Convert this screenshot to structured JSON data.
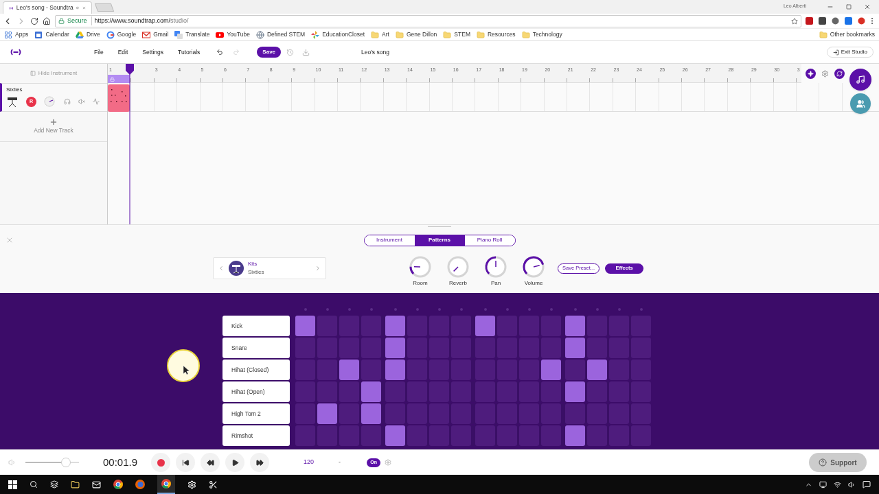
{
  "browser": {
    "tab": {
      "title": "Leo's song - Soundtra"
    },
    "user": "Leo Alberti",
    "secure": "Secure",
    "url": {
      "host": "https://www.soundtrap.com/",
      "path": "studio/"
    },
    "bookmarks": [
      {
        "label": "Apps",
        "kind": "apps"
      },
      {
        "label": "Calendar",
        "kind": "calendar"
      },
      {
        "label": "Drive",
        "kind": "drive"
      },
      {
        "label": "Google",
        "kind": "google"
      },
      {
        "label": "Gmail",
        "kind": "gmail"
      },
      {
        "label": "Translate",
        "kind": "translate"
      },
      {
        "label": "YouTube",
        "kind": "youtube"
      },
      {
        "label": "Defined STEM",
        "kind": "site"
      },
      {
        "label": "EducationCloset",
        "kind": "pinwheel"
      },
      {
        "label": "Art",
        "kind": "folder"
      },
      {
        "label": "Gene Dillon",
        "kind": "folder"
      },
      {
        "label": "STEM",
        "kind": "folder"
      },
      {
        "label": "Resources",
        "kind": "folder"
      },
      {
        "label": "Technology",
        "kind": "folder"
      }
    ],
    "other_bookmarks": "Other bookmarks"
  },
  "app": {
    "menu": [
      "File",
      "Edit",
      "Settings",
      "Tutorials"
    ],
    "save": "Save",
    "title": "Leo's song",
    "exit": "Exit Studio"
  },
  "tracks_panel": {
    "hide_instrument": "Hide Instrument",
    "tracks": [
      {
        "name": "Sixties",
        "selected": true,
        "record": "R"
      }
    ],
    "add_track": "Add New Track"
  },
  "ruler": [
    "1",
    "3",
    "4",
    "5",
    "6",
    "7",
    "8",
    "9",
    "10",
    "11",
    "12",
    "13",
    "14",
    "15",
    "16",
    "17",
    "18",
    "19",
    "20",
    "21",
    "22",
    "23",
    "24",
    "25",
    "26",
    "27",
    "28",
    "29",
    "30",
    "3"
  ],
  "instrument": {
    "tabs": [
      {
        "label": "Instrument",
        "selected": false
      },
      {
        "label": "Patterns",
        "selected": true
      },
      {
        "label": "Piano Roll",
        "selected": false
      }
    ],
    "kit": {
      "category": "Kits",
      "name": "Sixties"
    },
    "knobs": [
      {
        "label": "Room"
      },
      {
        "label": "Reverb"
      },
      {
        "label": "Pan"
      },
      {
        "label": "Volume"
      }
    ],
    "save_preset": "Save Preset...",
    "effects": "Effects"
  },
  "sequencer": {
    "rows": [
      {
        "label": "Kick",
        "steps": [
          true,
          false,
          false,
          false,
          true,
          false,
          false,
          false,
          true,
          false,
          false,
          false,
          true,
          false,
          false,
          false
        ]
      },
      {
        "label": "Snare",
        "steps": [
          false,
          false,
          false,
          false,
          true,
          false,
          false,
          false,
          false,
          false,
          false,
          false,
          true,
          false,
          false,
          false
        ]
      },
      {
        "label": "Hihat (Closed)",
        "steps": [
          false,
          false,
          true,
          false,
          true,
          false,
          false,
          false,
          false,
          false,
          false,
          true,
          false,
          true,
          false,
          false
        ]
      },
      {
        "label": "Hihat (Open)",
        "steps": [
          false,
          false,
          false,
          true,
          false,
          false,
          false,
          false,
          false,
          false,
          false,
          false,
          true,
          false,
          false,
          false
        ]
      },
      {
        "label": "High Tom 2",
        "steps": [
          false,
          true,
          false,
          true,
          false,
          false,
          false,
          false,
          false,
          false,
          false,
          false,
          false,
          false,
          false,
          false
        ]
      },
      {
        "label": "Rimshot",
        "steps": [
          false,
          false,
          false,
          false,
          true,
          false,
          false,
          false,
          false,
          false,
          false,
          false,
          true,
          false,
          false,
          false
        ]
      }
    ]
  },
  "transport": {
    "volume": {
      "level": 0.75
    },
    "time": "00:01.9",
    "tempo": "120",
    "key": "-",
    "metronome": {
      "label": "On",
      "on": true
    }
  },
  "support": "Support"
}
